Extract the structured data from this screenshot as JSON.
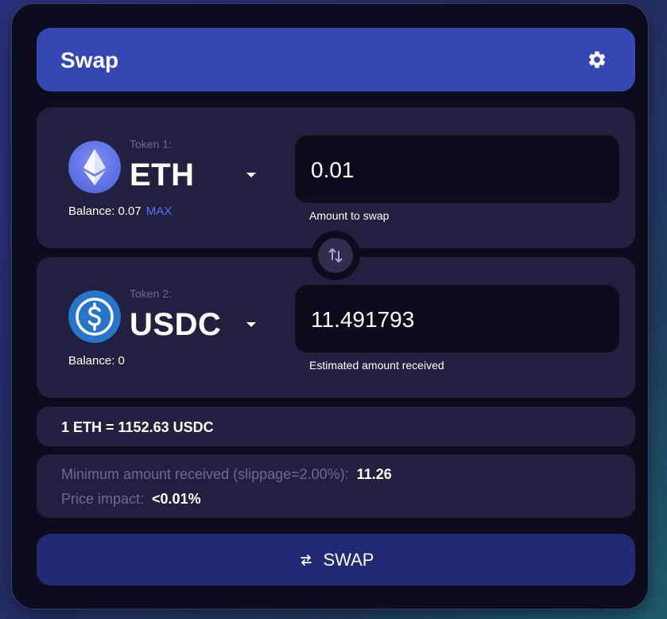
{
  "header": {
    "title": "Swap",
    "settings_icon": "gear-icon"
  },
  "token_in": {
    "label": "Token 1:",
    "symbol": "ETH",
    "logo_icon": "ethereum-logo-icon",
    "balance_text": "Balance: 0.07",
    "max_label": "MAX",
    "amount_value": "0.01",
    "amount_caption": "Amount to swap"
  },
  "token_out": {
    "label": "Token 2:",
    "symbol": "USDC",
    "logo_icon": "usdc-logo-icon",
    "balance_text": "Balance: 0",
    "amount_value": "11.491793",
    "amount_caption": "Estimated amount received"
  },
  "switch_icon": "swap-arrows-icon",
  "rate": {
    "text": "1 ETH = 1152.63 USDC"
  },
  "info": {
    "min_received_label": "Minimum amount received (slippage=2.00%):",
    "min_received_value": "11.26",
    "price_impact_label": "Price impact:",
    "price_impact_value": "<0.01%"
  },
  "swap_button": {
    "label": "SWAP",
    "icon": "exchange-arrows-icon"
  },
  "colors": {
    "card_bg": "#0d0c1d",
    "header_bg": "#3547b3",
    "panel_bg": "#22203f",
    "button_bg": "#222a73",
    "accent": "#5a6cff",
    "muted_text": "#6c6b8a"
  }
}
